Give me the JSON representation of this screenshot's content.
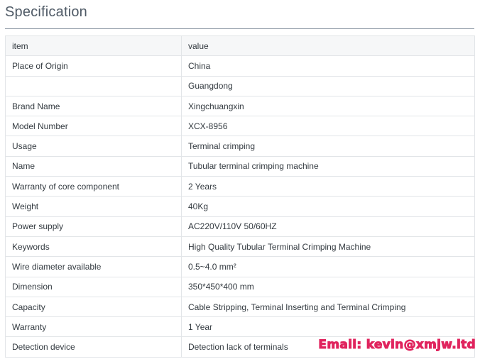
{
  "heading": "Specification",
  "table": {
    "header": {
      "item": "item",
      "value": "value"
    },
    "rows": [
      {
        "item": "Place of Origin",
        "value": "China"
      },
      {
        "item": "",
        "value": "Guangdong"
      },
      {
        "item": "Brand Name",
        "value": "Xingchuangxin"
      },
      {
        "item": "Model Number",
        "value": "XCX-8956"
      },
      {
        "item": "Usage",
        "value": "Terminal crimping"
      },
      {
        "item": "Name",
        "value": "Tubular terminal crimping machine"
      },
      {
        "item": "Warranty of core component",
        "value": "2 Years"
      },
      {
        "item": "Weight",
        "value": "40Kg"
      },
      {
        "item": "Power supply",
        "value": "AC220V/110V 50/60HZ"
      },
      {
        "item": "Keywords",
        "value": "High Quality Tubular Terminal Crimping Machine"
      },
      {
        "item": "Wire diameter available",
        "value": "0.5~4.0 mm²"
      },
      {
        "item": "Dimension",
        "value": "350*450*400 mm"
      },
      {
        "item": "Capacity",
        "value": "Cable Stripping, Terminal Inserting and Terminal Crimping"
      },
      {
        "item": "Warranty",
        "value": "1 Year"
      },
      {
        "item": "Detection device",
        "value": "Detection lack of terminals"
      }
    ]
  },
  "watermark": "Email: kevin@xmjw.ltd",
  "colors": {
    "heading": "#4f5a66",
    "header_bg": "#f6f7f8",
    "border": "#e2e5e8",
    "watermark": "#e0245e"
  }
}
